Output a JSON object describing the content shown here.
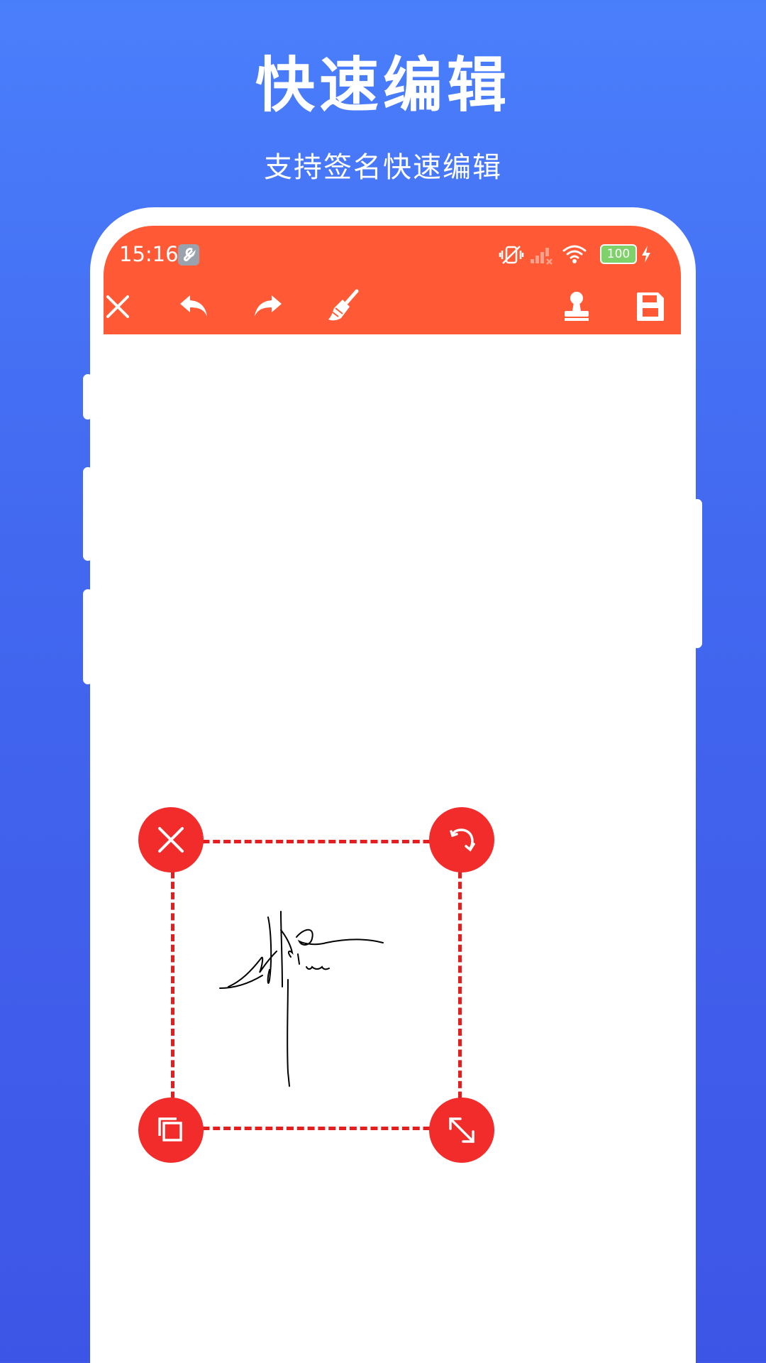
{
  "banner": {
    "title": "快速编辑",
    "subtitle": "支持签名快速编辑"
  },
  "status_bar": {
    "time": "15:16",
    "battery": "100",
    "icons": [
      "wrench-icon",
      "vibrate-off-icon",
      "signal-icon",
      "wifi-icon",
      "battery-icon",
      "charging-icon"
    ]
  },
  "toolbar": {
    "icons": [
      "close-icon",
      "undo-icon",
      "redo-icon",
      "broom-icon",
      "stamp-icon",
      "save-icon"
    ]
  },
  "colors": {
    "background_top": "#4a7ffb",
    "background_bottom": "#3d55e6",
    "appbar": "#ff5a35",
    "selection": "#e41e1e",
    "handle": "#f22b2b"
  },
  "selection_handles": [
    "delete-icon",
    "rotate-icon",
    "copy-icon",
    "resize-icon"
  ]
}
